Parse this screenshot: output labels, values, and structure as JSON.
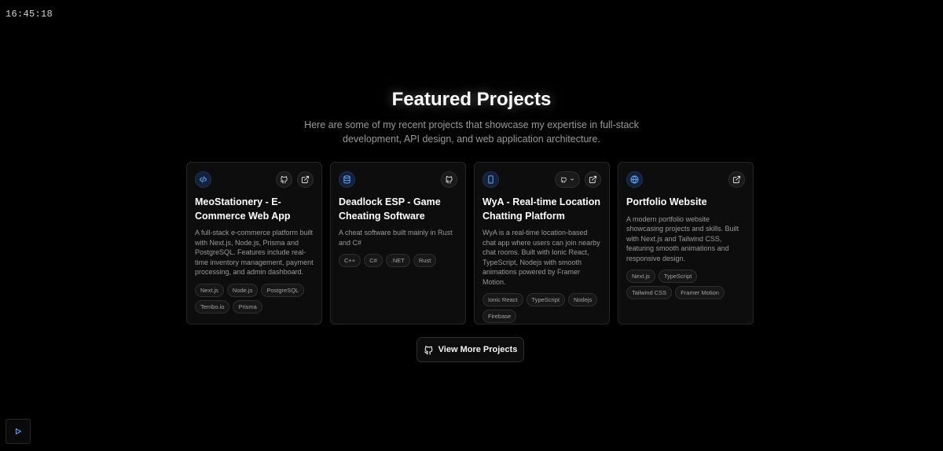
{
  "clock": {
    "time": "16:45:18"
  },
  "header": {
    "title": "Featured Projects",
    "subtitle": "Here are some of my recent projects that showcase my expertise in full-stack development, API design, and web application architecture."
  },
  "projects": [
    {
      "icon": "code-icon",
      "title": "MeoStationery - E-Commerce Web App",
      "description": "A full-stack e-commerce platform built with Next.js, Node.js, Prisma and PostgreSQL. Features include real-time inventory management, payment processing, and admin dashboard.",
      "tags": [
        "Next.js",
        "Node.js",
        "PostgreSQL",
        "Tembo.io",
        "Prisma"
      ]
    },
    {
      "icon": "database-icon",
      "title": "Deadlock ESP - Game Cheating Software",
      "description": "A cheat software built mainly in Rust and C#",
      "tags": [
        "C++",
        "C#",
        ".NET",
        "Rust"
      ]
    },
    {
      "icon": "mobile-icon",
      "title": "WyA - Real-time Location Chatting Platform",
      "description": "WyA is a real-time location-based chat app where users can join nearby chat rooms. Built with Ionic React, TypeScript, Nodejs with smooth animations powered by Framer Motion.",
      "tags": [
        "Ionic React",
        "TypeScript",
        "Nodejs",
        "Firebase"
      ]
    },
    {
      "icon": "globe-icon",
      "title": "Portfolio Website",
      "description": "A modern portfolio website showcasing projects and skills. Built with Next.js and Tailwind CSS, featuring smooth animations and responsive design.",
      "tags": [
        "Next.js",
        "TypeScript",
        "Tailwind CSS",
        "Framer Motion"
      ]
    }
  ],
  "footer": {
    "more_label": "View More Projects"
  },
  "colors": {
    "background": "#000000",
    "card": "#0d0d0d",
    "accent": "#60a5fa"
  }
}
